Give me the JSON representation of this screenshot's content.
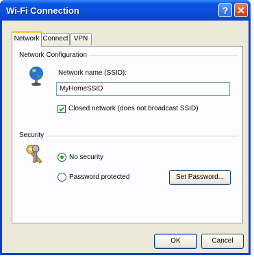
{
  "window": {
    "title": "Wi-Fi Connection",
    "help_label": "?",
    "close_label": "✕"
  },
  "tabs": [
    {
      "label": "Network",
      "active": true
    },
    {
      "label": "Connect",
      "active": false
    },
    {
      "label": "VPN",
      "active": false
    }
  ],
  "network_group": {
    "label": "Network Configuration",
    "icon": "globe-icon",
    "ssid_label": "Network name (SSID):",
    "ssid_value": "MyHomeSSID",
    "closed_network_label": "Closed network (does not broadcast SSID)",
    "closed_network_checked": true
  },
  "security_group": {
    "label": "Security",
    "icon": "keys-icon",
    "no_security_label": "No security",
    "password_protected_label": "Password protected",
    "selected": "No security",
    "set_password_label": "Set Password..."
  },
  "dialog_buttons": {
    "ok_label": "OK",
    "cancel_label": "Cancel"
  }
}
